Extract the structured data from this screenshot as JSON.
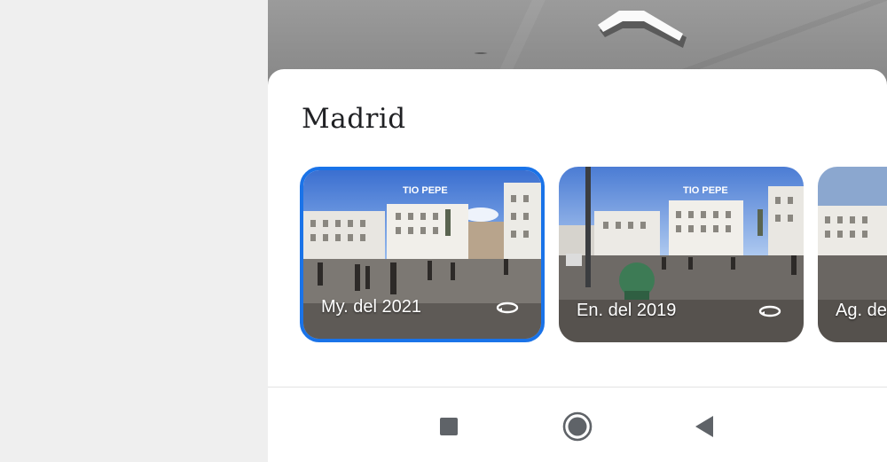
{
  "place": {
    "title": "Madrid"
  },
  "photos": [
    {
      "date": "My. del 2021",
      "selected": true,
      "icon": "panorama-360-icon",
      "sign_text": "TIO PEPE"
    },
    {
      "date": "En. del 2019",
      "selected": false,
      "icon": "panorama-360-icon",
      "sign_text": "TIO PEPE"
    },
    {
      "date": "Ag. de",
      "selected": false,
      "icon": "panorama-360-icon"
    }
  ],
  "android_nav": {
    "recents": "recents-square-icon",
    "home": "home-circle-icon",
    "back": "back-triangle-icon"
  },
  "colors": {
    "accent": "#1a73e8",
    "sheet": "#ffffff",
    "background": "#efefef",
    "nav_icon": "#5f6368"
  }
}
